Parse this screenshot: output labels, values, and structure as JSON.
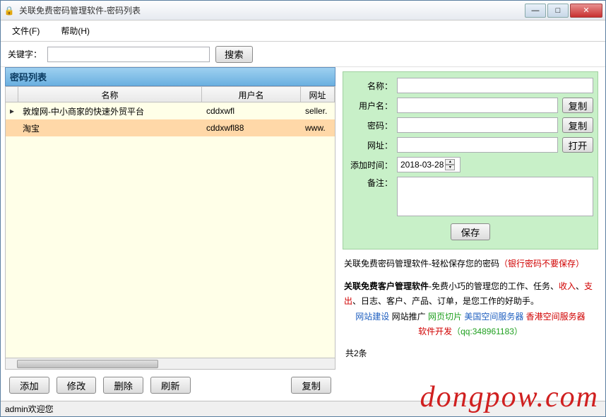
{
  "window": {
    "title": "关联免费密码管理软件-密码列表"
  },
  "menu": {
    "file": "文件(F)",
    "help": "帮助(H)"
  },
  "search": {
    "label": "关键字：",
    "value": "",
    "button": "搜索"
  },
  "list": {
    "header": "密码列表",
    "columns": {
      "name": "名称",
      "user": "用户名",
      "url": "网址"
    },
    "rows": [
      {
        "name": "敦煌网-中小商家的快速外贸平台",
        "user": "cddxwfl",
        "url": "seller."
      },
      {
        "name": "淘宝",
        "user": "cddxwfl88",
        "url": "www."
      }
    ]
  },
  "buttons": {
    "add": "添加",
    "edit": "修改",
    "delete": "删除",
    "refresh": "刷新",
    "copy": "复制"
  },
  "count": "共2条",
  "form": {
    "name_label": "名称：",
    "name_value": "",
    "user_label": "用户名：",
    "user_value": "",
    "pwd_label": "密码：",
    "pwd_value": "",
    "url_label": "网址：",
    "url_value": "",
    "date_label": "添加时间：",
    "date_value": "2018-03-28",
    "note_label": "备注：",
    "note_value": "",
    "copy_btn": "复制",
    "open_btn": "打开",
    "save_btn": "保存"
  },
  "ads": {
    "line1a": "关联免费密码管理软件-轻松保存您的密码",
    "line1b": "（银行密码不要保存）",
    "line2a": "关联免费客户管理软件",
    "line2b": "-免费小巧的管理您的工作、任务、",
    "line2c": "收入",
    "line2d": "、",
    "line2e": "支出",
    "line2f": "、日志、客户、产品、订单，是您工作的好助手。",
    "line3a": "网站建设",
    "line3b": " 网站推广 ",
    "line3c": "网页切片",
    "line3d": " 美国空间服务器",
    "line3e": " 香港空间服务器",
    "line4a": "软件开发",
    "line4b": "（qq:348961183）"
  },
  "status": "admin欢迎您",
  "watermark": "dongpow.com"
}
